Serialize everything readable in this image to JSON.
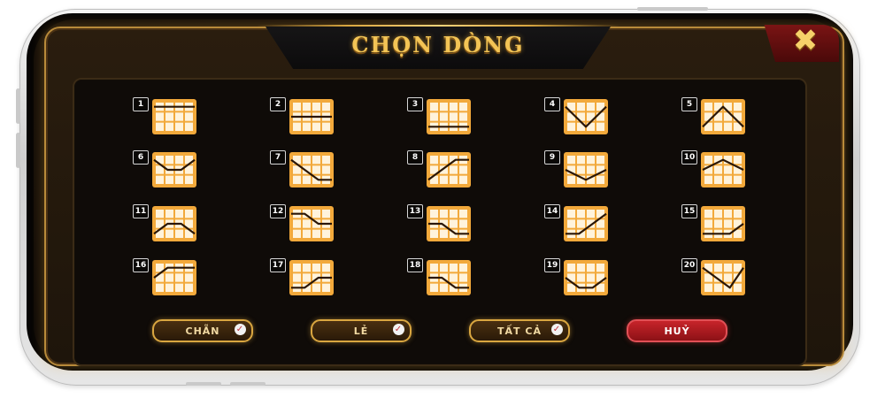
{
  "dialog": {
    "title": "CHỌN DÒNG",
    "close_icon": "close-icon",
    "accent_color": "#F2A93B",
    "red_color": "#C7242A"
  },
  "lines": [
    {
      "number": "1",
      "pattern": [
        0,
        0,
        0,
        0
      ]
    },
    {
      "number": "2",
      "pattern": [
        1,
        1,
        1,
        1
      ]
    },
    {
      "number": "3",
      "pattern": [
        2,
        2,
        2,
        2
      ]
    },
    {
      "number": "4",
      "pattern": [
        0,
        1,
        2,
        1,
        0
      ]
    },
    {
      "number": "5",
      "pattern": [
        2,
        1,
        0,
        1,
        2
      ]
    },
    {
      "number": "6",
      "pattern": [
        0,
        1,
        1,
        0
      ]
    },
    {
      "number": "7",
      "pattern": [
        0,
        1,
        2,
        2
      ]
    },
    {
      "number": "8",
      "pattern": [
        2,
        1,
        0,
        0
      ]
    },
    {
      "number": "9",
      "pattern": [
        1,
        2,
        1
      ]
    },
    {
      "number": "10",
      "pattern": [
        1,
        0,
        1
      ]
    },
    {
      "number": "11",
      "pattern": [
        2,
        1,
        1,
        2
      ]
    },
    {
      "number": "12",
      "pattern": [
        0,
        0,
        1,
        1
      ]
    },
    {
      "number": "13",
      "pattern": [
        1,
        1,
        2,
        2
      ]
    },
    {
      "number": "14",
      "pattern": [
        2,
        2,
        1,
        0
      ]
    },
    {
      "number": "15",
      "pattern": [
        2,
        2,
        2,
        1
      ]
    },
    {
      "number": "16",
      "pattern": [
        1,
        0,
        0,
        0
      ]
    },
    {
      "number": "17",
      "pattern": [
        2,
        2,
        1,
        1
      ]
    },
    {
      "number": "18",
      "pattern": [
        1,
        1,
        2,
        2
      ]
    },
    {
      "number": "19",
      "pattern": [
        1,
        2,
        2,
        1
      ]
    },
    {
      "number": "20",
      "pattern": [
        0,
        1,
        2,
        0
      ]
    }
  ],
  "buttons": {
    "even_label": "CHẴN",
    "odd_label": "LẺ",
    "all_label": "TẤT CẢ",
    "cancel_label": "HUỶ",
    "check_icon": "check-icon"
  }
}
